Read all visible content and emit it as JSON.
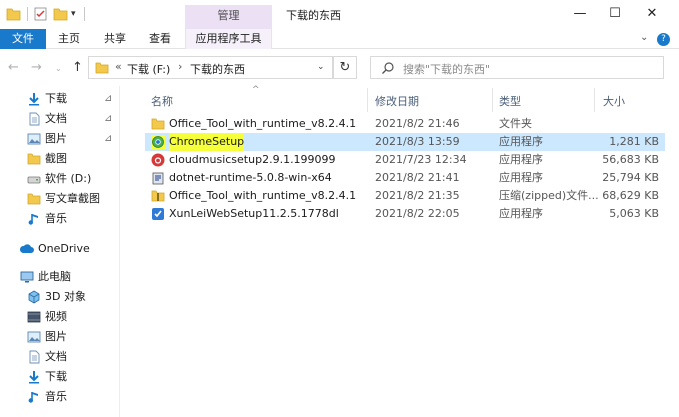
{
  "colors": {
    "accent": "#1979ca",
    "selection": "#cce8ff",
    "manage_tab": "#ece0f5",
    "highlight": "#f5ff3a",
    "folder": "#f2c94c"
  },
  "titlebar": {
    "manage_tab": "管理",
    "title": "下载的东西",
    "min": "—",
    "max": "☐",
    "close": "✕",
    "dropdown": "▾"
  },
  "ribbon": {
    "tabs": [
      "文件",
      "主页",
      "共享",
      "查看",
      "应用程序工具"
    ],
    "collapse": "⌄",
    "help": "?"
  },
  "address": {
    "back": "←",
    "forward": "→",
    "history": "⌄",
    "up": "↑",
    "chevron": "«",
    "drive": "下载 (F:)",
    "sep": "›",
    "current": "下载的东西",
    "dropdown": "⌄",
    "refresh": "↻",
    "search_placeholder": "搜索\"下载的东西\""
  },
  "navpane": {
    "items": [
      {
        "label": "下载",
        "icon": "download-arrow-icon",
        "pinned": true
      },
      {
        "label": "文档",
        "icon": "document-icon",
        "pinned": true
      },
      {
        "label": "图片",
        "icon": "picture-icon",
        "pinned": true
      },
      {
        "label": "截图",
        "icon": "folder-icon",
        "pinned": false
      },
      {
        "label": "软件 (D:)",
        "icon": "drive-icon",
        "pinned": false
      },
      {
        "label": "写文章截图",
        "icon": "folder-icon",
        "pinned": false
      },
      {
        "label": "音乐",
        "icon": "music-icon",
        "pinned": false
      },
      {
        "label": "OneDrive",
        "icon": "cloud-icon",
        "pinned": false
      },
      {
        "label": "此电脑",
        "icon": "computer-icon",
        "pinned": false
      },
      {
        "label": "3D 对象",
        "icon": "cube-icon",
        "pinned": false
      },
      {
        "label": "视频",
        "icon": "video-icon",
        "pinned": false
      },
      {
        "label": "图片",
        "icon": "picture-icon",
        "pinned": false
      },
      {
        "label": "文档",
        "icon": "document-icon",
        "pinned": false
      },
      {
        "label": "下载",
        "icon": "download-arrow-icon",
        "pinned": false
      },
      {
        "label": "音乐",
        "icon": "music-icon",
        "pinned": false
      }
    ],
    "pin_glyph": "⊿"
  },
  "table": {
    "headers": {
      "name": "名称",
      "date": "修改日期",
      "type": "类型",
      "size": "大小"
    },
    "sort_glyph": "^",
    "rows": [
      {
        "name": "Office_Tool_with_runtime_v8.2.4.1",
        "date": "2021/8/2 21:46",
        "type": "文件夹",
        "size": "",
        "icon": "folder-icon"
      },
      {
        "name": "ChromeSetup",
        "date": "2021/8/3 13:59",
        "type": "应用程序",
        "size": "1,281 KB",
        "icon": "chrome-installer-icon"
      },
      {
        "name": "cloudmusicsetup2.9.1.199099",
        "date": "2021/7/23 12:34",
        "type": "应用程序",
        "size": "56,683 KB",
        "icon": "netease-music-icon"
      },
      {
        "name": "dotnet-runtime-5.0.8-win-x64",
        "date": "2021/8/2 21:41",
        "type": "应用程序",
        "size": "25,794 KB",
        "icon": "installer-icon"
      },
      {
        "name": "Office_Tool_with_runtime_v8.2.4.1",
        "date": "2021/8/2 21:35",
        "type": "压缩(zipped)文件...",
        "size": "68,629 KB",
        "icon": "zip-folder-icon"
      },
      {
        "name": "XunLeiWebSetup11.2.5.1778dl",
        "date": "2021/8/2 22:05",
        "type": "应用程序",
        "size": "5,063 KB",
        "icon": "xunlei-icon"
      }
    ]
  }
}
